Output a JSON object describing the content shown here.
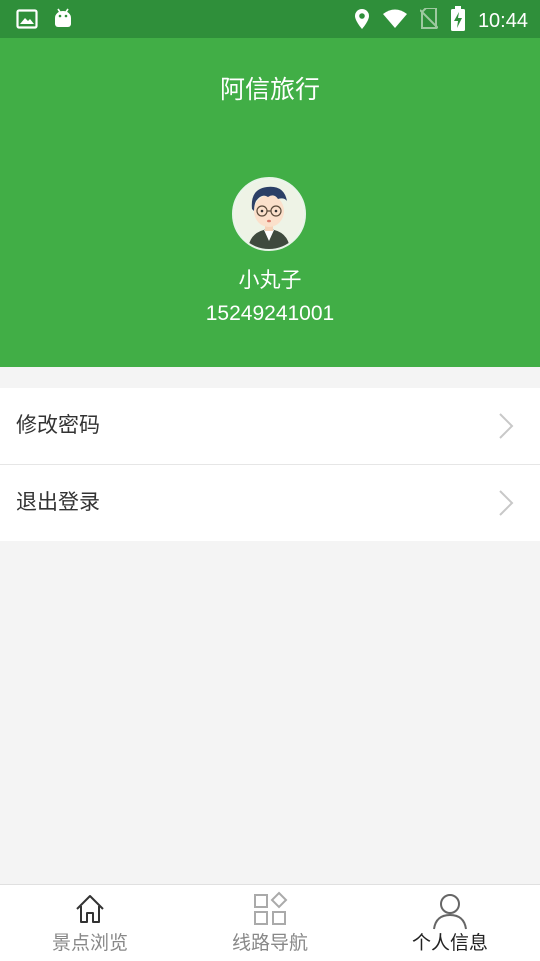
{
  "status_bar": {
    "time": "10:44",
    "icons": [
      "gallery-icon",
      "android-icon",
      "location-icon",
      "wifi-icon",
      "no-sim-icon",
      "battery-charging-icon"
    ]
  },
  "header": {
    "title": "阿信旅行",
    "username": "小丸子",
    "phone": "15249241001",
    "background": "#41ae46"
  },
  "menu": {
    "items": [
      {
        "label": "修改密码",
        "icon": "chevron-right-icon"
      },
      {
        "label": "退出登录",
        "icon": "chevron-right-icon"
      }
    ]
  },
  "bottom_nav": {
    "items": [
      {
        "label": "景点浏览",
        "icon": "home-icon",
        "active": false
      },
      {
        "label": "线路导航",
        "icon": "grid-icon",
        "active": false
      },
      {
        "label": "个人信息",
        "icon": "person-icon",
        "active": true
      }
    ]
  }
}
